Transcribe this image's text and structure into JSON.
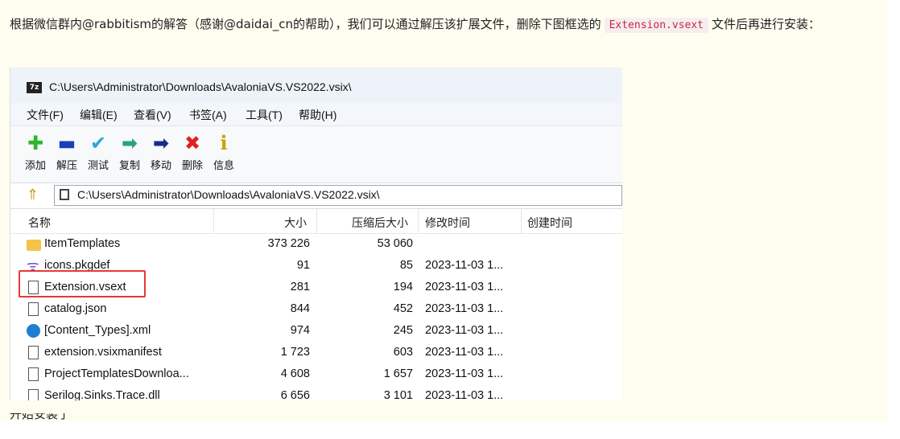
{
  "article": {
    "para_text": "根据微信群内@rabbitism的解答（感谢@daidai_cn的帮助），我们可以通过解压该扩展文件，删除下图框选的",
    "para_code": "Extension.vsext",
    "para_tail": "文件后再进行安装：",
    "cut_text": "开始安装了"
  },
  "window": {
    "title": "C:\\Users\\Administrator\\Downloads\\AvaloniaVS.VS2022.vsix\\",
    "app_icon": "7z"
  },
  "menu": [
    "文件(F)",
    "编辑(E)",
    "查看(V)",
    "书签(A)",
    "工具(T)",
    "帮助(H)"
  ],
  "toolbar": [
    {
      "label": "添加",
      "icon": "plus-icon",
      "glyph": "✚",
      "color": "#2fb52f"
    },
    {
      "label": "解压",
      "icon": "minus-icon",
      "glyph": "▬",
      "color": "#1b3fb8"
    },
    {
      "label": "测试",
      "icon": "check-chevron-icon",
      "glyph": "✔",
      "color": "#2aa7d6"
    },
    {
      "label": "复制",
      "icon": "copy-arrow-icon",
      "glyph": "➡",
      "color": "#2aa37a"
    },
    {
      "label": "移动",
      "icon": "move-arrow-icon",
      "glyph": "➡",
      "color": "#1b2a8a"
    },
    {
      "label": "删除",
      "icon": "delete-x-icon",
      "glyph": "✖",
      "color": "#e02020"
    },
    {
      "label": "信息",
      "icon": "info-icon",
      "glyph": "i",
      "color": "#c9a400"
    }
  ],
  "address": {
    "path": "C:\\Users\\Administrator\\Downloads\\AvaloniaVS.VS2022.vsix\\"
  },
  "columns": [
    "名称",
    "大小",
    "压缩后大小",
    "修改时间",
    "创建时间"
  ],
  "files": [
    {
      "name": "ItemTemplates",
      "size": "373 226",
      "packed": "53 060",
      "modified": "",
      "icon": "folder-icon"
    },
    {
      "name": "icons.pkgdef",
      "size": "91",
      "packed": "85",
      "modified": "2023-11-03 1...",
      "icon": "vs-file-icon"
    },
    {
      "name": "Extension.vsext",
      "size": "281",
      "packed": "194",
      "modified": "2023-11-03 1...",
      "icon": "file-icon"
    },
    {
      "name": "catalog.json",
      "size": "844",
      "packed": "452",
      "modified": "2023-11-03 1...",
      "icon": "file-icon"
    },
    {
      "name": "[Content_Types].xml",
      "size": "974",
      "packed": "245",
      "modified": "2023-11-03 1...",
      "icon": "edge-icon"
    },
    {
      "name": "extension.vsixmanifest",
      "size": "1 723",
      "packed": "603",
      "modified": "2023-11-03 1...",
      "icon": "file-icon"
    },
    {
      "name": "ProjectTemplatesDownloa...",
      "size": "4 608",
      "packed": "1 657",
      "modified": "2023-11-03 1...",
      "icon": "file-icon"
    },
    {
      "name": "Serilog.Sinks.Trace.dll",
      "size": "6 656",
      "packed": "3 101",
      "modified": "2023-11-03 1...",
      "icon": "file-icon"
    }
  ],
  "highlight_color": "#e53935"
}
